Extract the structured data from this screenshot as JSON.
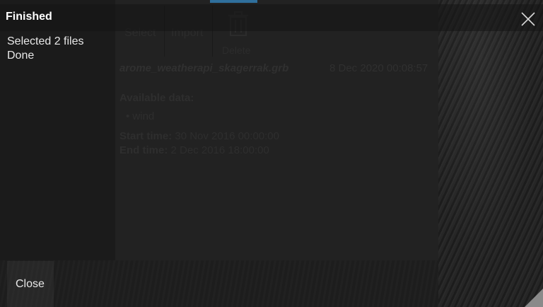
{
  "dialog": {
    "title": "Finished",
    "messages": [
      "Selected 2 files",
      "Done"
    ],
    "close_label": "Close"
  },
  "underlying": {
    "toolbar": {
      "select_label": "Select",
      "import_label": "Import",
      "delete_label": "Delete"
    },
    "file": {
      "name": "arome_weatherapi_skagerrak.grb",
      "date": "8 Dec 2020 00:08:57"
    },
    "available_title": "Available data:",
    "available_items": [
      "wind"
    ],
    "start_label": "Start time:",
    "start_value": "30 Nov 2016 00:00:00",
    "end_label": "End time:",
    "end_value": "2 Dec 2016 18:00:00"
  },
  "colors": {
    "accent": "#2f6f9c",
    "text": "#e8e8e8",
    "title": "#ffffff"
  },
  "icons": {
    "close": "close-x-icon",
    "trash": "trash-icon",
    "resize": "resize-corner-icon"
  }
}
